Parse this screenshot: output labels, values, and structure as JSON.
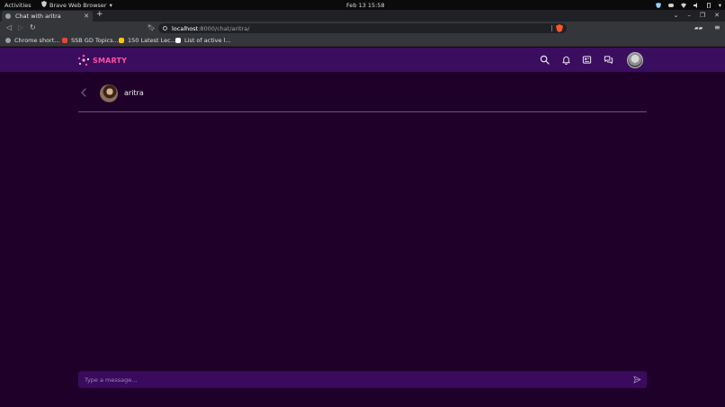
{
  "system_bar": {
    "activities": "Activities",
    "app_name": "Brave Web Browser",
    "clock": "Feb 13  15:58"
  },
  "browser": {
    "tab_title": "Chat with aritra",
    "url_host": "localhost",
    "url_rest": ":8000/chat/aritra/",
    "bookmarks": [
      {
        "label": "Chrome short...",
        "color": "#9aa0a6"
      },
      {
        "label": "SSB GD Topics...",
        "color": "#e8453c"
      },
      {
        "label": "150 Latest Lec...",
        "color": "#f5c518"
      },
      {
        "label": "List of active l...",
        "color": "#ffffff"
      }
    ]
  },
  "app": {
    "logo_text": "SMARTY",
    "chat": {
      "contact_name": "aritra",
      "message_placeholder": "Type a message..."
    }
  },
  "colors": {
    "page_bg": "#1e0029",
    "nav_bg": "#3b0d5e",
    "accent_pink": "#ff4fa3",
    "composer_bg": "#3a0a5e"
  }
}
